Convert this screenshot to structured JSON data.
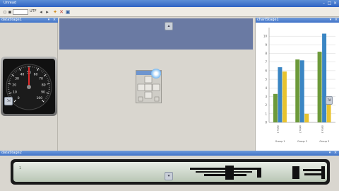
{
  "window": {
    "title": "Unread",
    "controls": {
      "minimize": "–",
      "maximize": "□",
      "close": "×"
    }
  },
  "toolbar": {
    "zoom_label": "UTF",
    "buttons": [
      "prev-icon",
      "next-icon",
      "star-icon",
      "close-icon",
      "save-icon"
    ]
  },
  "panels": {
    "left": {
      "title": "dataStage1",
      "close": "×"
    },
    "right": {
      "title": "chartStage1",
      "close": "×"
    },
    "bottom": {
      "title": "dataStage2",
      "close": "×"
    }
  },
  "gauge": {
    "ticks": [
      "0",
      "10",
      "20",
      "30",
      "40",
      "50",
      "60",
      "70",
      "80",
      "90",
      "100"
    ],
    "needle_value": 50,
    "max": 100
  },
  "chart_data": {
    "type": "bar",
    "ylim": [
      0,
      11
    ],
    "yticks": [
      "0",
      "1",
      "2",
      "3",
      "4",
      "5",
      "6",
      "7",
      "8",
      "9",
      "10"
    ],
    "categories": [
      "Group 1",
      "Group 2",
      "Group 3"
    ],
    "category_labels": [
      "data 1",
      "data 2",
      "data 3"
    ],
    "series": [
      {
        "color": "#6d9a3a",
        "values": [
          3.3,
          7.3,
          8.2
        ]
      },
      {
        "color": "#3b86c4",
        "values": [
          6.4,
          7.2,
          10.3
        ]
      },
      {
        "color": "#e8c32e",
        "values": [
          5.9,
          1.0,
          2.8
        ]
      }
    ],
    "grid": true
  },
  "strip": {
    "left_label": "1"
  }
}
